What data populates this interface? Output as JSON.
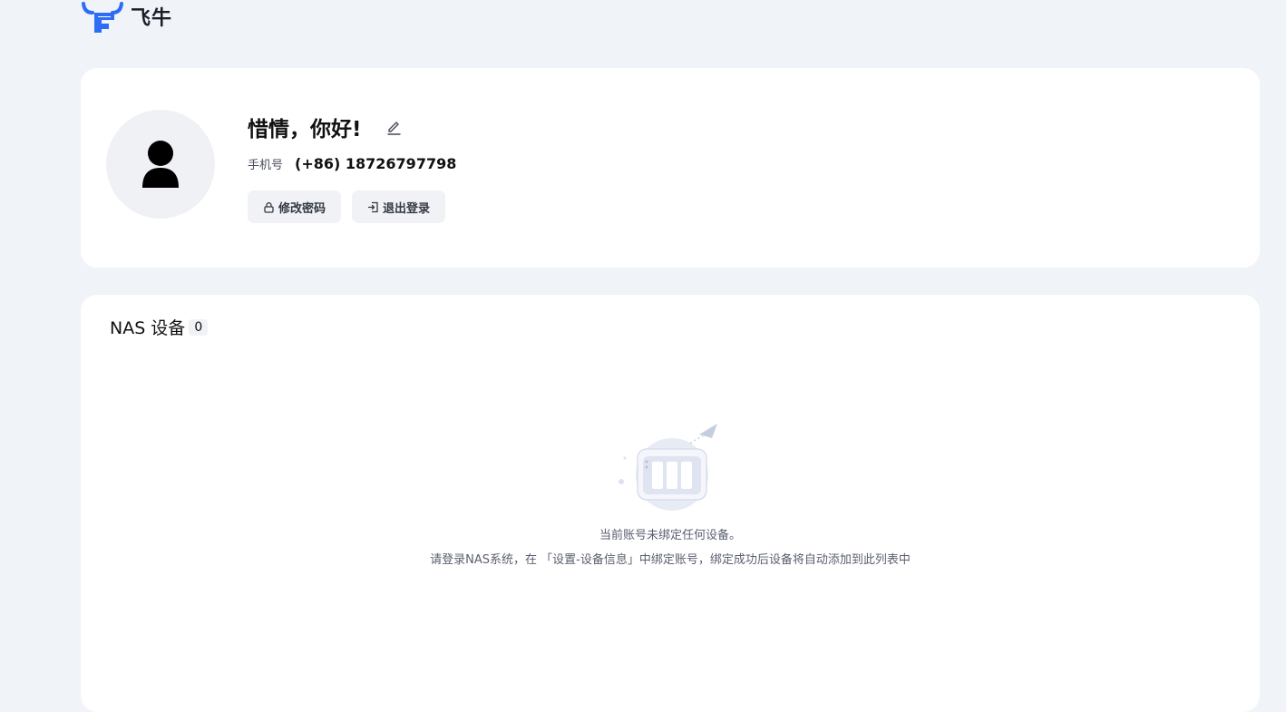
{
  "brand": {
    "name": "飞牛",
    "accent": "#2e6cf6",
    "logo_icon": "bull-logo-icon"
  },
  "profile": {
    "greeting": "惜情，你好!",
    "edit_icon": "edit-pencil-icon",
    "phone_label": "手机号",
    "phone_value": "(+86) 18726797798",
    "avatar_icon": "user-silhouette-icon",
    "change_password_label": "修改密码",
    "change_password_icon": "lock-icon",
    "logout_label": "退出登录",
    "logout_icon": "logout-icon"
  },
  "devices": {
    "title": "NAS 设备",
    "count": "0",
    "empty_icon": "nas-device-illustration",
    "empty_line1": "当前账号未绑定任何设备。",
    "empty_line2": "请登录NAS系统，在 「设置-设备信息」中绑定账号，绑定成功后设备将自动添加到此列表中"
  }
}
